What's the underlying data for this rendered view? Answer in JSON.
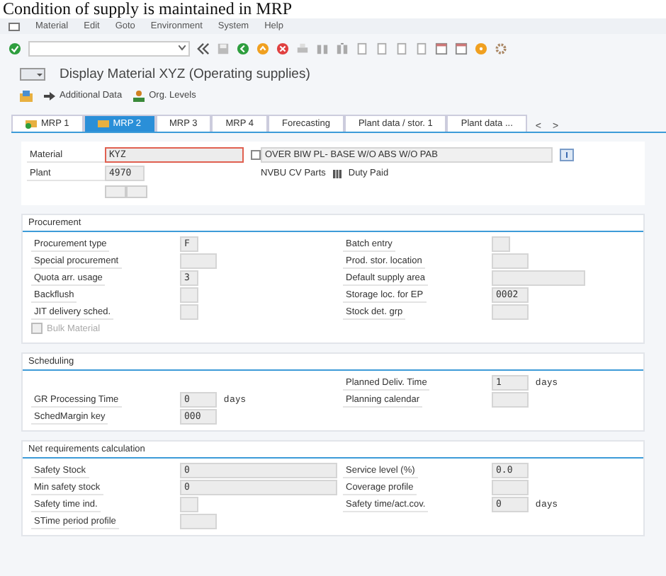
{
  "doc_caption": "Condition of supply is maintained in MRP",
  "menu": [
    {
      "label": "Material"
    },
    {
      "label": "Edit"
    },
    {
      "label": "Goto"
    },
    {
      "label": "Environment"
    },
    {
      "label": "System"
    },
    {
      "label": "Help"
    }
  ],
  "title": "Display Material XYZ (Operating supplies)",
  "app_toolbar": [
    {
      "label": "Additional Data"
    },
    {
      "label": "Org. Levels"
    }
  ],
  "tabs": [
    {
      "label": "MRP 1",
      "selected": false,
      "icon": true
    },
    {
      "label": "MRP 2",
      "selected": true,
      "icon": true
    },
    {
      "label": "MRP 3",
      "selected": false,
      "icon": false
    },
    {
      "label": "MRP 4",
      "selected": false,
      "icon": false
    },
    {
      "label": "Forecasting",
      "selected": false,
      "icon": false
    },
    {
      "label": "Plant data / stor. 1",
      "selected": false,
      "icon": false
    },
    {
      "label": "Plant data ...",
      "selected": false,
      "icon": false
    }
  ],
  "tab_scroll": [
    "<",
    ">"
  ],
  "header": {
    "material": {
      "label": "Material",
      "value": "KYZ",
      "description": "OVER BIW PL- BASE W/O ABS W/O PAB"
    },
    "plant": {
      "label": "Plant",
      "value": "4970",
      "description": "NVBU CV Parts",
      "note": "Duty Paid"
    }
  },
  "sections": [
    {
      "title": "Procurement",
      "rows": [
        {
          "left": {
            "label": "Procurement type",
            "value": "F"
          },
          "right": {
            "label": "Batch entry"
          }
        },
        {
          "left": {
            "label": "Special procurement"
          },
          "right": {
            "label": "Prod. stor. location"
          }
        },
        {
          "left": {
            "label": "Quota arr. usage",
            "value": "3"
          },
          "right": {
            "label": "Default supply area"
          }
        },
        {
          "left": {
            "label": "Backflush"
          },
          "right": {
            "label": "Storage loc. for EP",
            "value": "0002"
          }
        },
        {
          "left": {
            "label": "JIT delivery sched."
          },
          "right": {
            "label": "Stock det. grp"
          }
        }
      ],
      "checkbox": {
        "label": "Bulk Material",
        "checked": false,
        "disabled": true
      }
    },
    {
      "title": "Scheduling",
      "rows": [
        {
          "right": {
            "label": "Planned Deliv. Time",
            "value": "1",
            "unit": "days"
          }
        },
        {
          "left": {
            "label": "GR Processing Time",
            "value": "0",
            "unit": "days"
          },
          "right": {
            "label": "Planning calendar"
          }
        },
        {
          "left": {
            "label": "SchedMargin key",
            "value": "000"
          }
        }
      ]
    },
    {
      "title": "Net requirements calculation",
      "rows": [
        {
          "left": {
            "label": "Safety Stock",
            "value": "0"
          },
          "right": {
            "label": "Service level (%)",
            "value": "0.0"
          }
        },
        {
          "left": {
            "label": "Min safety stock",
            "value": "0"
          },
          "right": {
            "label": "Coverage profile"
          }
        },
        {
          "left": {
            "label": "Safety time ind."
          },
          "right": {
            "label": "Safety time/act.cov.",
            "value": "0",
            "unit": "days"
          }
        },
        {
          "left": {
            "label": "STime period profile"
          }
        }
      ]
    }
  ]
}
